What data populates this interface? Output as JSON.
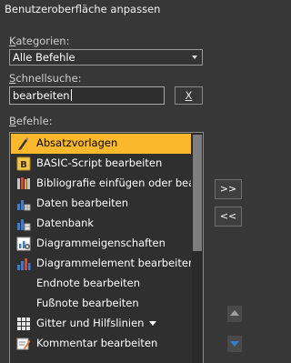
{
  "window": {
    "title": "Benutzeroberfläche anpassen"
  },
  "categories": {
    "label_pre": "",
    "label_key": "K",
    "label_post": "ategorien:",
    "selected": "Alle Befehle"
  },
  "quicksearch": {
    "label_pre": "",
    "label_key": "S",
    "label_post": "chnellsuche:",
    "value": "bearbeiten",
    "clear_label": "X"
  },
  "commands": {
    "label_pre": "",
    "label_key": "B",
    "label_post": "efehle:",
    "items": [
      {
        "label": "Absatzvorlagen",
        "icon": "paragraph-styles-icon",
        "selected": true
      },
      {
        "label": "BASIC-Script bearbeiten",
        "icon": "basic-script-icon"
      },
      {
        "label": "Bibliografie einfügen oder bearbeiten",
        "icon": "bibliography-icon"
      },
      {
        "label": "Daten bearbeiten",
        "icon": "chart-data-icon"
      },
      {
        "label": "Datenbank",
        "icon": "database-icon"
      },
      {
        "label": "Diagrammeigenschaften",
        "icon": "chart-properties-icon"
      },
      {
        "label": "Diagrammelement bearbeiten",
        "icon": "chart-element-icon"
      },
      {
        "label": "Endnote bearbeiten",
        "icon": ""
      },
      {
        "label": "Fußnote bearbeiten",
        "icon": ""
      },
      {
        "label": "Gitter und Hilfslinien",
        "icon": "grid-icon",
        "submenu": true
      },
      {
        "label": "Kommentar bearbeiten",
        "icon": "comment-icon"
      }
    ]
  },
  "side_buttons": {
    "add": ">>",
    "remove": "<<"
  },
  "colors": {
    "background": "#373737",
    "selection": "#fab92d",
    "text": "#ffffff"
  }
}
